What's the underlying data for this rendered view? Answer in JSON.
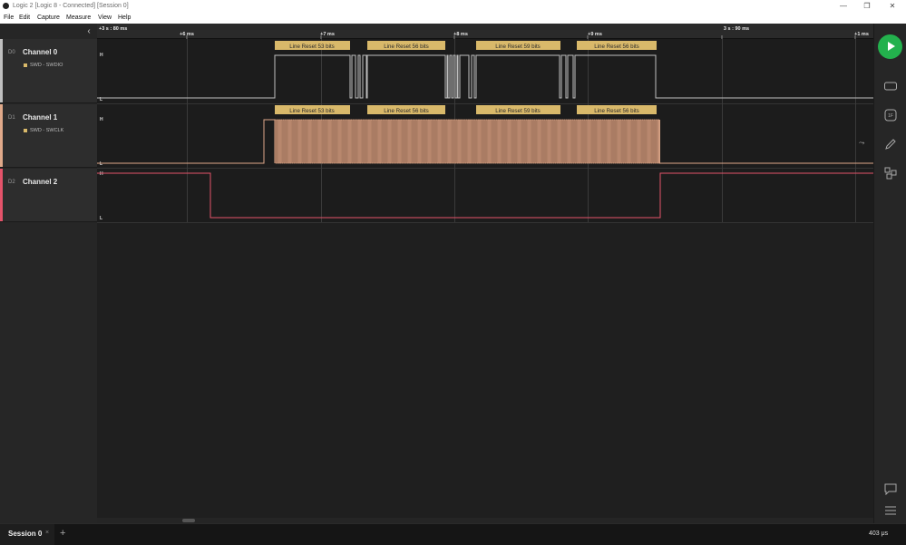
{
  "window": {
    "title": "Logic 2 [Logic 8 - Connected] [Session 0]",
    "minimize_glyph": "—",
    "maximize_glyph": "❐",
    "close_glyph": "✕"
  },
  "menu": [
    "File",
    "Edit",
    "Capture",
    "Measure",
    "View",
    "Help"
  ],
  "ruler": {
    "start_label": "+3 s : 80 ms",
    "ticks": [
      "+6 ms",
      "+7 ms",
      "+8 ms",
      "+9 ms",
      "3 s : 90 ms",
      "+1 ms"
    ]
  },
  "channels": [
    {
      "id": "D0",
      "name": "Channel 0",
      "analyzer": "SWD - SWDIO",
      "color": "#bfbfbf",
      "high": "H",
      "low": "L"
    },
    {
      "id": "D1",
      "name": "Channel 1",
      "analyzer": "SWD - SWCLK",
      "color": "#e0a98a",
      "high": "H",
      "low": "L"
    },
    {
      "id": "D2",
      "name": "Channel 2",
      "analyzer": "",
      "color": "#e4536a",
      "high": "H",
      "low": "L"
    }
  ],
  "annotations": {
    "channel0": [
      "Line Reset 53 bits",
      "Line Reset 56 bits",
      "Line Reset 59 bits",
      "Line Reset 56 bits"
    ],
    "channel1": [
      "Line Reset 53 bits",
      "Line Reset 56 bits",
      "Line Reset 59 bits",
      "Line Reset 56 bits"
    ]
  },
  "colors": {
    "annotation_bg": "#d9b96a",
    "accent_green": "#23b14d"
  },
  "side_icons": [
    "analyzers-icon",
    "measure-icon",
    "annotations-icon",
    "extensions-icon",
    "notes-icon",
    "menu-icon"
  ],
  "session": {
    "tab_label": "Session 0",
    "close": "×",
    "add": "+"
  },
  "status": {
    "zoom": "403 μs"
  }
}
